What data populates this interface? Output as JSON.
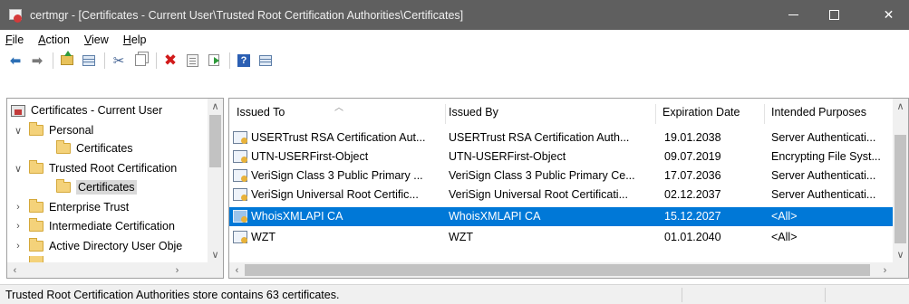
{
  "window": {
    "title": "certmgr - [Certificates - Current User\\Trusted Root Certification Authorities\\Certificates]",
    "minimize_label": "—",
    "maximize_label": "",
    "close_label": "✕"
  },
  "menu": {
    "items": [
      {
        "label": "File",
        "underline": "F",
        "rest": "ile"
      },
      {
        "label": "Action",
        "underline": "A",
        "rest": "ction"
      },
      {
        "label": "View",
        "underline": "V",
        "rest": "iew"
      },
      {
        "label": "Help",
        "underline": "H",
        "rest": "elp"
      }
    ]
  },
  "toolbar": {
    "icons": [
      "back-arrow-icon",
      "forward-arrow-icon",
      "up-folder-icon",
      "show-hide-tree-icon",
      "cut-icon",
      "copy-icon",
      "delete-icon",
      "properties-icon",
      "export-icon",
      "help-icon",
      "view-icon"
    ]
  },
  "tree": {
    "items": [
      {
        "label": "Certificates - Current User",
        "expander": "",
        "level": 0,
        "icon": "root"
      },
      {
        "label": "Personal",
        "expander": "∨",
        "level": 1,
        "icon": "folder"
      },
      {
        "label": "Certificates",
        "expander": "",
        "level": 2,
        "icon": "folder"
      },
      {
        "label": "Trusted Root Certification",
        "expander": "∨",
        "level": 1,
        "icon": "folder"
      },
      {
        "label": "Certificates",
        "expander": "",
        "level": 2,
        "icon": "folder",
        "selected": true
      },
      {
        "label": "Enterprise Trust",
        "expander": "›",
        "level": 1,
        "icon": "folder"
      },
      {
        "label": "Intermediate Certification",
        "expander": "›",
        "level": 1,
        "icon": "folder"
      },
      {
        "label": "Active Directory User Obje",
        "expander": "›",
        "level": 1,
        "icon": "folder"
      }
    ]
  },
  "list": {
    "columns": [
      "Issued To",
      "Issued By",
      "Expiration Date",
      "Intended Purposes"
    ],
    "rows": [
      {
        "issued_to": "USERTrust RSA Certification Aut...",
        "issued_by": "USERTrust RSA Certification Auth...",
        "expiration": "19.01.2038",
        "purposes": "Server Authenticati...",
        "selected": false
      },
      {
        "issued_to": "UTN-USERFirst-Object",
        "issued_by": "UTN-USERFirst-Object",
        "expiration": "09.07.2019",
        "purposes": "Encrypting File Syst...",
        "selected": false
      },
      {
        "issued_to": "VeriSign Class 3 Public Primary ...",
        "issued_by": "VeriSign Class 3 Public Primary Ce...",
        "expiration": "17.07.2036",
        "purposes": "Server Authenticati...",
        "selected": false
      },
      {
        "issued_to": "VeriSign Universal Root Certific...",
        "issued_by": "VeriSign Universal Root Certificati...",
        "expiration": "02.12.2037",
        "purposes": "Server Authenticati...",
        "selected": false
      },
      {
        "issued_to": "WhoisXMLAPI CA",
        "issued_by": "WhoisXMLAPI CA",
        "expiration": "15.12.2027",
        "purposes": "<All>",
        "selected": true
      },
      {
        "issued_to": "WZT",
        "issued_by": "WZT",
        "expiration": "01.01.2040",
        "purposes": "<All>",
        "selected": false
      }
    ]
  },
  "status": {
    "text": "Trusted Root Certification Authorities store contains 63 certificates."
  },
  "colors": {
    "titlebar": "#5f5f5f",
    "selection": "#0078d7"
  }
}
